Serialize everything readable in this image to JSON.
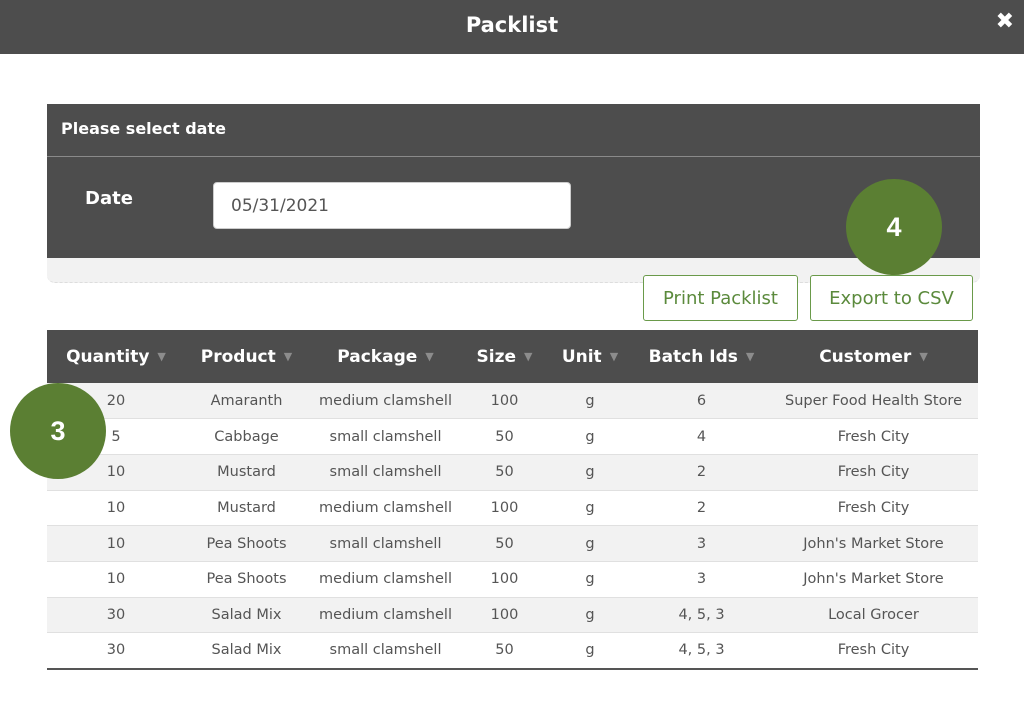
{
  "dialog": {
    "title": "Packlist",
    "close_label": "✖"
  },
  "date_panel": {
    "heading": "Please select date",
    "date_label": "Date",
    "date_value": "05/31/2021"
  },
  "buttons": {
    "print": "Print Packlist",
    "export": "Export to CSV"
  },
  "markers": {
    "m3": "3",
    "m4": "4"
  },
  "table": {
    "columns": [
      "Quantity",
      "Product",
      "Package",
      "Size",
      "Unit",
      "Batch Ids",
      "Customer"
    ],
    "rows": [
      [
        "20",
        "Amaranth",
        "medium clamshell",
        "100",
        "g",
        "6",
        "Super Food Health Store"
      ],
      [
        "5",
        "Cabbage",
        "small clamshell",
        "50",
        "g",
        "4",
        "Fresh City"
      ],
      [
        "10",
        "Mustard",
        "small clamshell",
        "50",
        "g",
        "2",
        "Fresh City"
      ],
      [
        "10",
        "Mustard",
        "medium clamshell",
        "100",
        "g",
        "2",
        "Fresh City"
      ],
      [
        "10",
        "Pea Shoots",
        "small clamshell",
        "50",
        "g",
        "3",
        "John's Market Store"
      ],
      [
        "10",
        "Pea Shoots",
        "medium clamshell",
        "100",
        "g",
        "3",
        "John's Market Store"
      ],
      [
        "30",
        "Salad Mix",
        "medium clamshell",
        "100",
        "g",
        "4, 5, 3",
        "Local Grocer"
      ],
      [
        "30",
        "Salad Mix",
        "small clamshell",
        "50",
        "g",
        "4, 5, 3",
        "Fresh City"
      ]
    ]
  },
  "colors": {
    "header_bg": "#4d4d4d",
    "accent_green": "#5b7f33",
    "button_border": "#6a9a4a"
  }
}
